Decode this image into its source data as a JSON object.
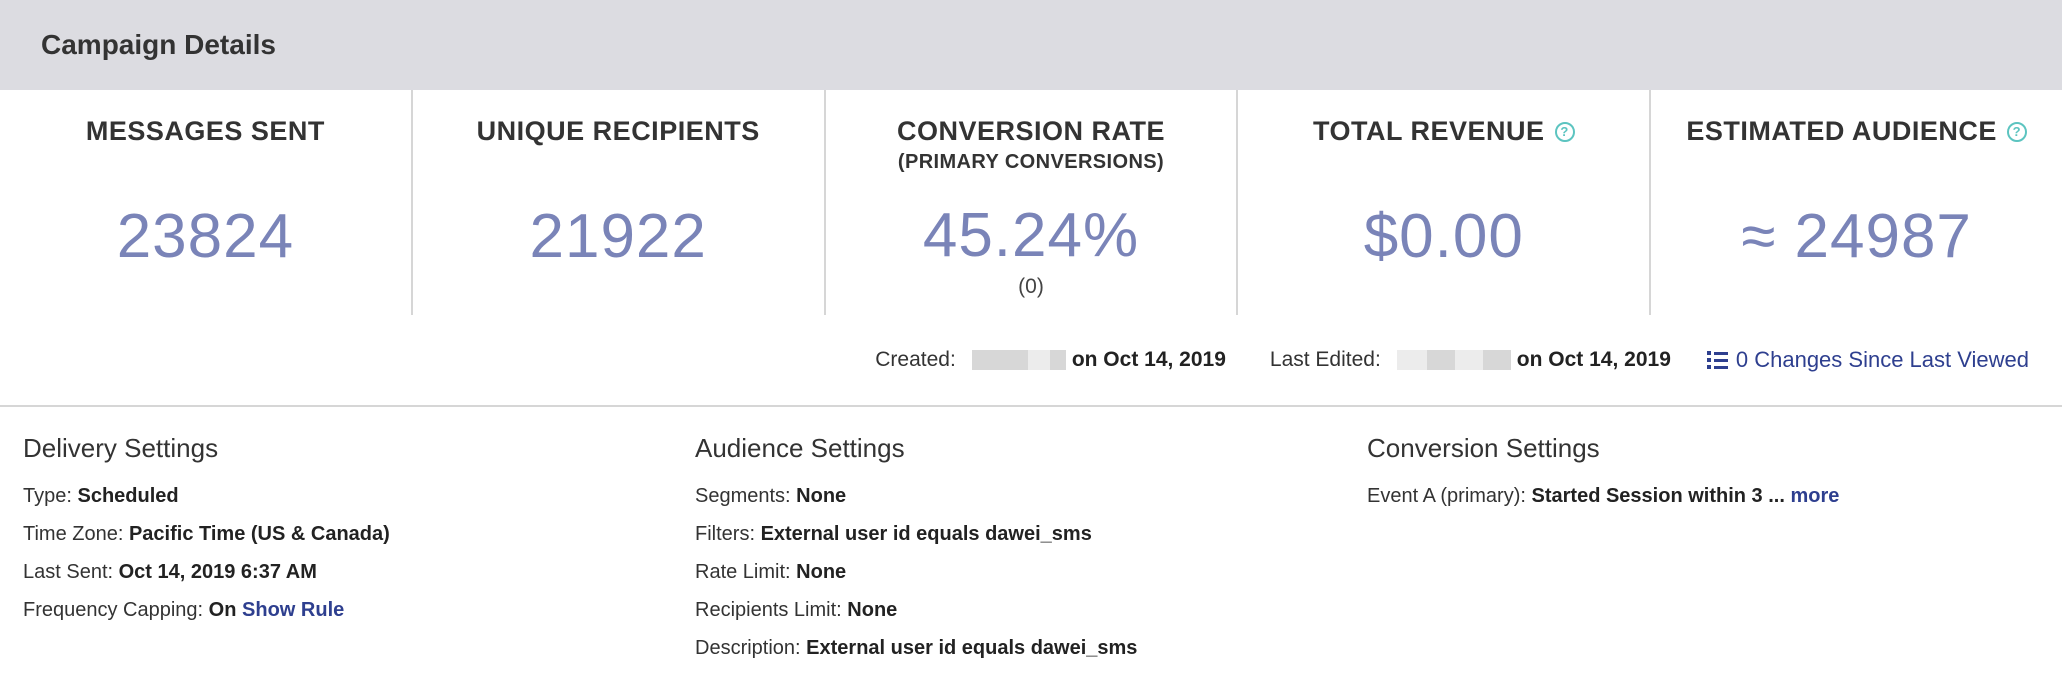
{
  "header": {
    "title": "Campaign Details"
  },
  "stats": [
    {
      "label": "MESSAGES SENT",
      "value": "23824"
    },
    {
      "label": "UNIQUE RECIPIENTS",
      "value": "21922"
    },
    {
      "label": "CONVERSION RATE",
      "sublabel": "(PRIMARY CONVERSIONS)",
      "value": "45.24%",
      "note": "(0)"
    },
    {
      "label": "TOTAL REVENUE",
      "value": "$0.00"
    },
    {
      "label": "ESTIMATED AUDIENCE",
      "value": "≈ 24987"
    }
  ],
  "icons": {
    "help": "question-circle-icon",
    "list": "list-icon"
  },
  "colors": {
    "stat_value": "#7a84b8",
    "link": "#2e3f8f",
    "help": "#5cc4c0",
    "header_bg": "#dcdce1"
  },
  "meta": {
    "created_label": "Created:",
    "created_date": "on Oct 14, 2019",
    "edited_label": "Last Edited:",
    "edited_date": "on Oct 14, 2019",
    "changes_link": "0 Changes Since Last Viewed"
  },
  "help_glyph": "?",
  "delivery": {
    "title": "Delivery Settings",
    "type_label": "Type:",
    "type_value": "Scheduled",
    "tz_label": "Time Zone:",
    "tz_value": "Pacific Time (US & Canada)",
    "last_label": "Last Sent:",
    "last_value": "Oct 14, 2019 6:37 AM",
    "freq_label": "Frequency Capping:",
    "freq_value": "On",
    "freq_link": "Show Rule"
  },
  "audience": {
    "title": "Audience Settings",
    "seg_label": "Segments:",
    "seg_value": "None",
    "filter_label": "Filters:",
    "filter_value": "External user id equals dawei_sms",
    "rate_label": "Rate Limit:",
    "rate_value": "None",
    "recip_label": "Recipients Limit:",
    "recip_value": "None",
    "desc_label": "Description:",
    "desc_value": "External user id equals dawei_sms"
  },
  "conversion": {
    "title": "Conversion Settings",
    "event_label": "Event A (primary):",
    "event_value": "Started Session within 3 ...",
    "more_link": "more"
  }
}
